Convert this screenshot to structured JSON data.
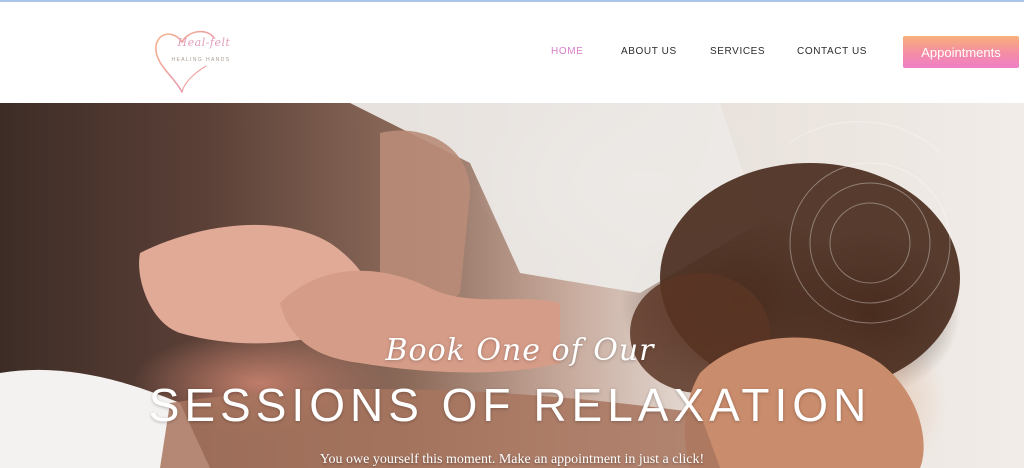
{
  "brand": {
    "logo_script": "Heal-felt",
    "logo_tagline": "HEALING HANDS",
    "colors": {
      "accent_pink": "#d77fc8",
      "button_start": "#f8b07a",
      "button_end": "#ef7fc7"
    }
  },
  "nav": {
    "items": [
      {
        "label": "HOME",
        "active": true
      },
      {
        "label": "ABOUT US",
        "active": false
      },
      {
        "label": "SERVICES",
        "active": false
      },
      {
        "label": "CONTACT US",
        "active": false
      }
    ],
    "cta_label": "Appointments"
  },
  "hero": {
    "script_line": "Book One of Our",
    "title": "SESSIONS OF RELAXATION",
    "subtitle": "You owe yourself this moment. Make an appointment in just a click!"
  }
}
